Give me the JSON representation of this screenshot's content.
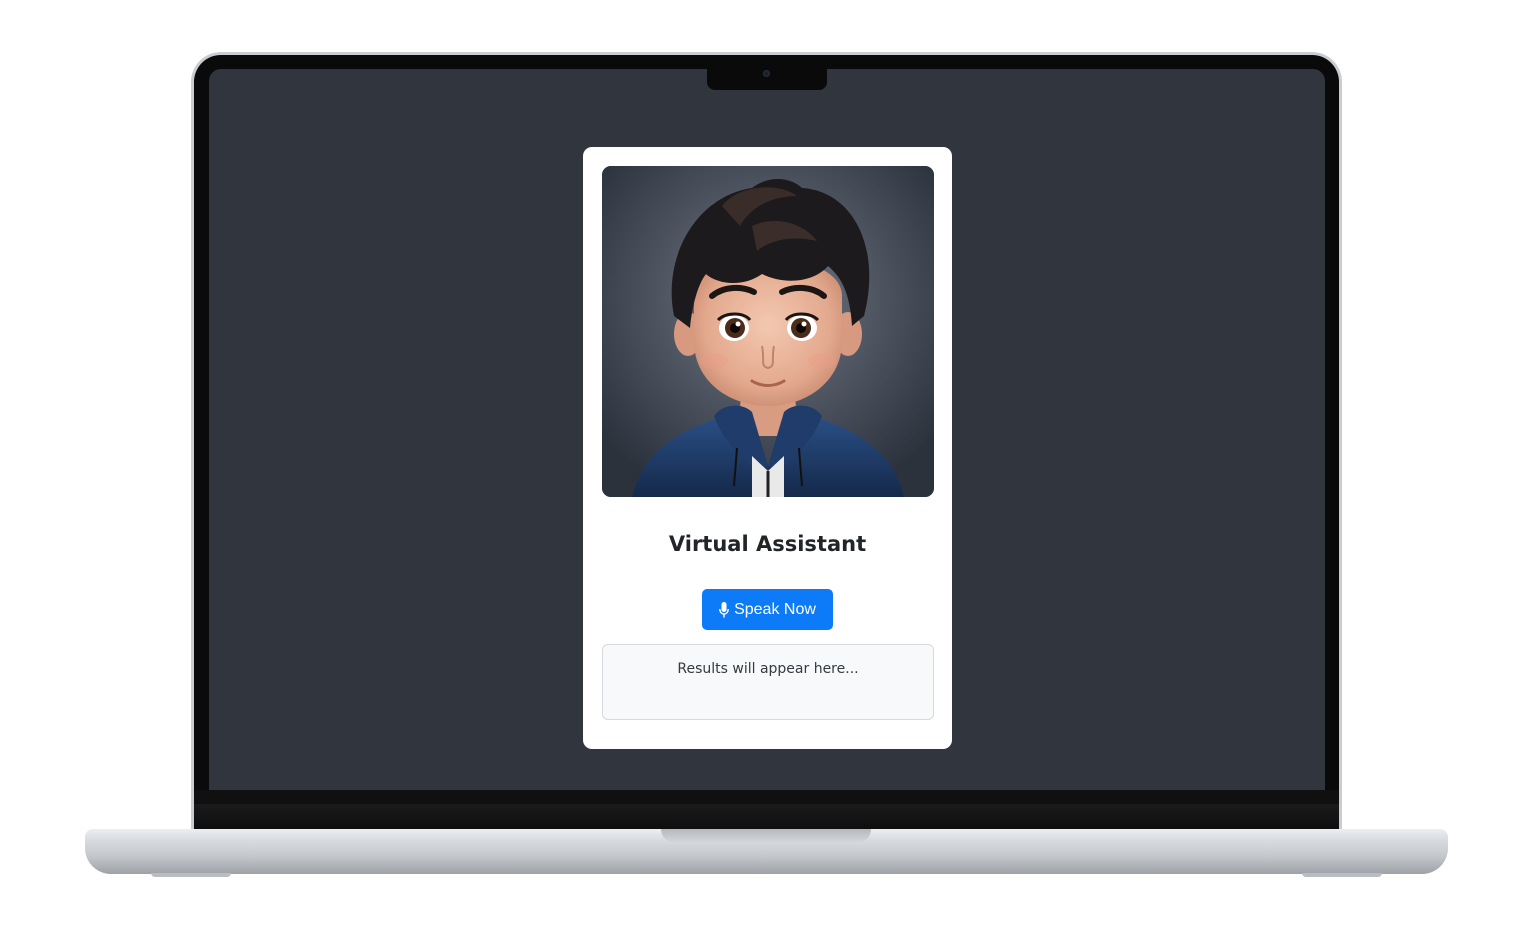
{
  "assistant": {
    "title": "Virtual Assistant",
    "avatar_icon": "avatar-boy-illustration"
  },
  "controls": {
    "speak_label": "Speak Now",
    "speak_icon": "microphone-icon",
    "accent_color": "#0d7bf8"
  },
  "results": {
    "placeholder_text": "Results will appear here..."
  },
  "theme": {
    "screen_background": "#31353e",
    "card_background": "#ffffff"
  }
}
